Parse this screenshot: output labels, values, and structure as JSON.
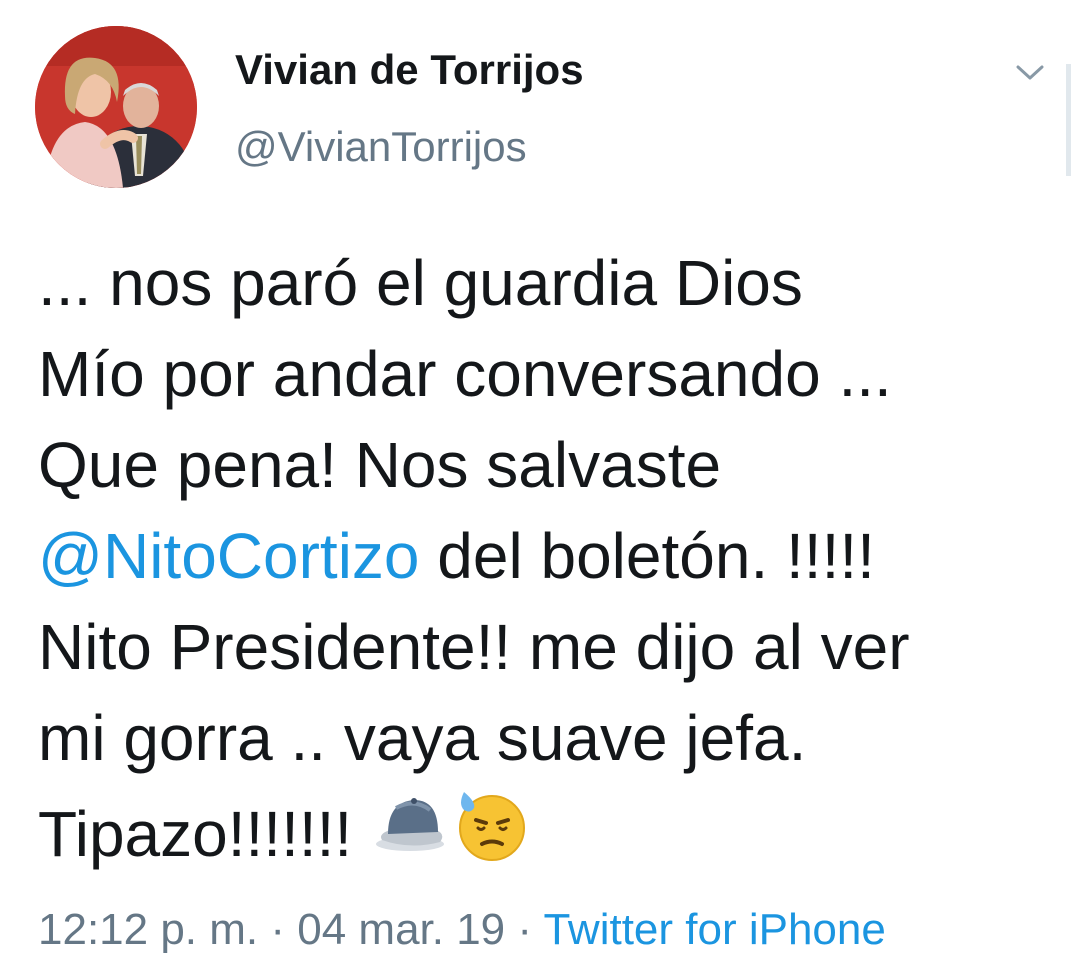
{
  "tweet": {
    "display_name": "Vivian de Torrijos",
    "handle": "@VivianTorrijos",
    "lines": {
      "l1": "...   nos paró el guardia Dios",
      "l2": "Mío por andar conversando ...",
      "l3": "Que pena!  Nos salvaste",
      "l4_mention": "@NitoCortizo",
      "l4_rest": " del boletón. !!!!!",
      "l5": "Nito Presidente!!  me dijo al ver",
      "l6": "mi  gorra ..   vaya suave jefa.",
      "l7": "Tipazo!!!!!!!  "
    },
    "emojis": [
      "billed-cap-emoji",
      "downcast-face-with-sweat-emoji"
    ],
    "time": "12:12 p. m.",
    "separator": " · ",
    "date": "04 mar. 19",
    "source": "Twitter for iPhone"
  },
  "colors": {
    "text": "#14171a",
    "secondary": "#657786",
    "link": "#1b95e0",
    "avatar_background": "#c8362d"
  }
}
